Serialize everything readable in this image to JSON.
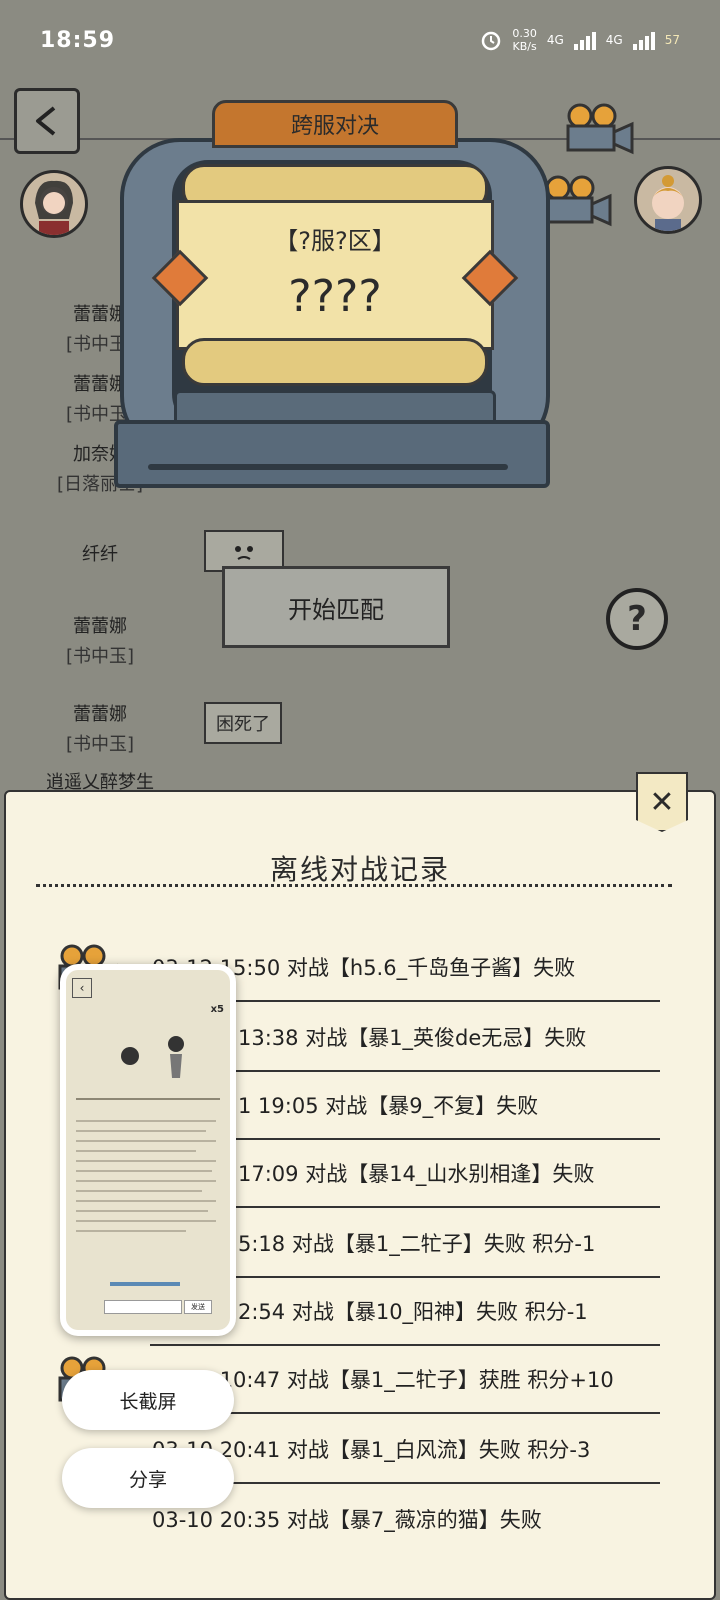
{
  "status_bar": {
    "time": "18:59",
    "net_speed_top": "0.30",
    "net_speed_bottom": "KB/s",
    "sig1": "4G",
    "sig2": "4G",
    "battery": "57"
  },
  "machine": {
    "title": "跨服对决",
    "server": "【?服?区】",
    "opponent": "????",
    "start_button": "开始匹配"
  },
  "chat": [
    {
      "name": "蕾蕾娜",
      "tag": "[书中玉]"
    },
    {
      "name": "蕾蕾娜",
      "tag": "[书中玉]"
    },
    {
      "name": "加奈妲",
      "tag": "[日落丽士]"
    },
    {
      "name": "纤纤",
      "tag": ""
    },
    {
      "name": "蕾蕾娜",
      "tag": "[书中玉]"
    },
    {
      "name": "蕾蕾娜",
      "tag": "[书中玉]"
    },
    {
      "name": "逍遥乂醉梦生",
      "tag": ""
    }
  ],
  "chat_bubble": "困死了",
  "help_label": "?",
  "panel": {
    "title": "离线对战记录",
    "close": "✕",
    "records": [
      "03-12 15:50 对战【h5.6_千岛鱼子酱】失败",
      "13:38 对战【暴1_英俊de无忌】失败",
      "1 19:05 对战【暴9_不复】失败",
      "17:09 对战【暴14_山水别相逢】失败",
      "5:18 对战【暴1_二牤子】失败 积分-1",
      "2:54 对战【暴10_阳神】失败 积分-1",
      "03-11 10:47 对战【暴1_二牤子】获胜 积分+10",
      "03-10 20:41 对战【暴1_白风流】失败 积分-3",
      "03-10 20:35 对战【暴7_薇凉的猫】失败"
    ]
  },
  "screenshot_overlay": {
    "long_screenshot": "长截屏",
    "share": "分享",
    "badge": "x5",
    "send": "发送"
  }
}
